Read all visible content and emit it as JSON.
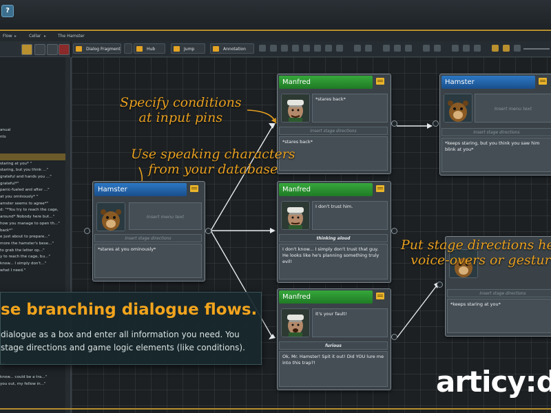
{
  "colors": {
    "accent": "#b8902f",
    "annotation": "#e8a020",
    "node_green": "#2a9a30",
    "node_blue": "#2363a8",
    "overlay_title": "#f2a41d"
  },
  "topbar": {
    "help_label": "?"
  },
  "breadcrumb": [
    "Flow",
    "Cellar",
    "The Hamster"
  ],
  "toolbar": {
    "buttons": [
      "Dialog Fragment",
      "Hub",
      "Jump",
      "Annotation"
    ]
  },
  "left_list": [
    "",
    "",
    "",
    "",
    "",
    "",
    "",
    "",
    "",
    "",
    "anual",
    "nts",
    "",
    "",
    "",
    "staring at you* \"",
    "staring, but you think ...\"",
    "grateful and hands you ...\"",
    "grateful*\"",
    "panic-fueled and after ...\"",
    "at you ominously* \"",
    "amster seems to agree*\"",
    "d: \"*You try to reach the cage,",
    "around* Nobody here but...\"",
    "how you manage to open th...\"",
    "back*\"",
    "e just about to prepare...\"",
    "more the hamster's bese...\"",
    "to grab the letter op...\"",
    "y to reach the cage, bu...\"",
    "know... I simply don't...\"",
    "what I need.\"",
    "",
    "",
    "",
    "",
    "",
    "",
    "",
    "",
    "",
    "",
    "",
    "",
    "",
    "nts",
    "",
    "know... could be a tra...\"",
    "you out, my fellow in...\""
  ],
  "nodes": [
    {
      "speaker": "Hamster",
      "text": "*stares at you ominously*",
      "menu_placeholder": "Insert menu text",
      "stage_placeholder": "Insert stage directions"
    },
    {
      "speaker": "Manfred",
      "text": "*stares back*",
      "stage_placeholder": "Insert stage directions",
      "body": "*stares back*"
    },
    {
      "speaker": "Manfred",
      "text": "I don't trust him.",
      "stage": "thinking aloud",
      "body": "I don't know... I simply don't trust that guy. He looks like he's planning something truly evil!"
    },
    {
      "speaker": "Manfred",
      "text": "It's your fault!",
      "stage": "furious",
      "body": "Ok, Mr. Hamster! Spit it out! Did YOU lure me into this trap?!"
    },
    {
      "speaker": "Hamster",
      "menu_placeholder": "Insert menu text",
      "stage_placeholder": "Insert stage directions",
      "body": "*keeps staring, but you think you saw him blink at you*"
    },
    {
      "stage_placeholder": "Insert stage directions",
      "body": "*keeps staring at you*"
    }
  ],
  "annotations": {
    "conditions": [
      "Specify conditions",
      "at input pins"
    ],
    "speakers": [
      "Use speaking characters",
      "from your database"
    ],
    "stage": [
      "Put stage directions her",
      "voice-overs or gestur"
    ]
  },
  "overlay": {
    "title": "se branching dialogue flows.",
    "line1": "dialogue as a box and enter all information you need. You",
    "line2": "stage directions and game logic elements (like conditions)."
  },
  "logo": "articy:d"
}
